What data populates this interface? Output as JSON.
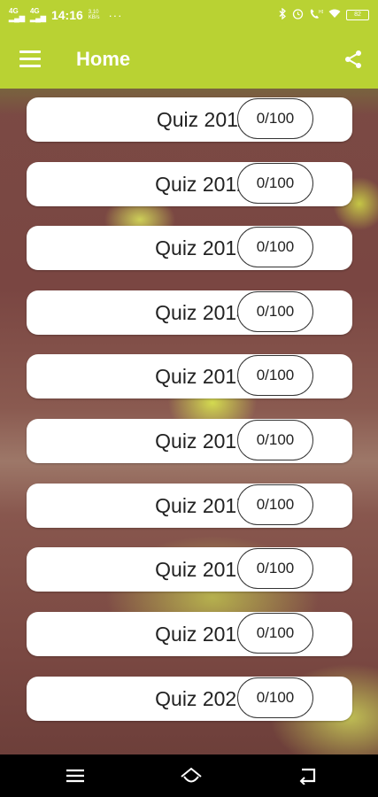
{
  "status_bar": {
    "signal_1": "4G",
    "signal_2": "4G",
    "time": "14:16",
    "speed_value": "3.10",
    "speed_unit": "KB/s",
    "more": "···",
    "battery": "82"
  },
  "app_bar": {
    "title": "Home",
    "color": "#b9d233"
  },
  "quizzes": [
    {
      "label": "Quiz 2011",
      "score": "0/100"
    },
    {
      "label": "Quiz 2012",
      "score": "0/100"
    },
    {
      "label": "Quiz 2013",
      "score": "0/100"
    },
    {
      "label": "Quiz 2014",
      "score": "0/100"
    },
    {
      "label": "Quiz 2015",
      "score": "0/100"
    },
    {
      "label": "Quiz 2016",
      "score": "0/100"
    },
    {
      "label": "Quiz 2017",
      "score": "0/100"
    },
    {
      "label": "Quiz 2018",
      "score": "0/100"
    },
    {
      "label": "Quiz 2019",
      "score": "0/100"
    },
    {
      "label": "Quiz 2020",
      "score": "0/100"
    }
  ],
  "icons": {
    "menu": "menu-icon",
    "share": "share-icon",
    "nav_menu": "nav-menu-icon",
    "nav_home": "nav-home-icon",
    "nav_back": "nav-back-icon"
  }
}
